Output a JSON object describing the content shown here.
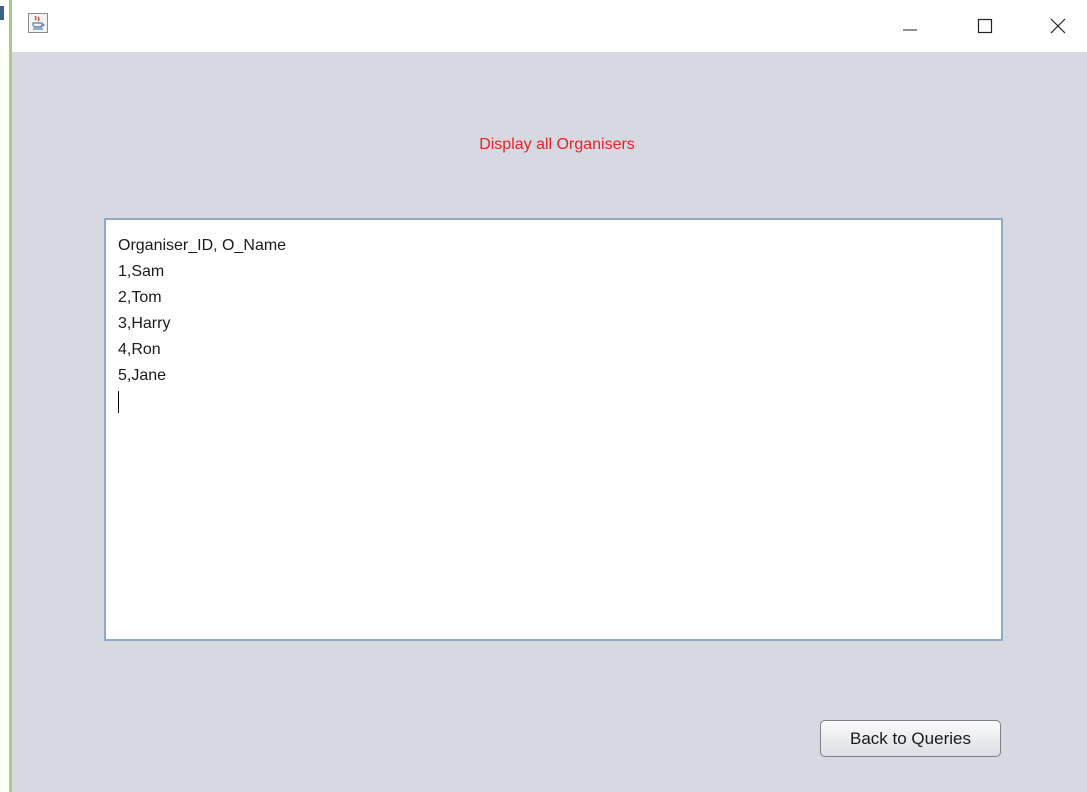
{
  "window": {
    "title": "",
    "controls": {
      "minimize_icon": "minimize-icon",
      "maximize_icon": "maximize-icon",
      "close_icon": "close-icon"
    }
  },
  "content": {
    "title": "Display all Organisers",
    "title_color": "#e8212a",
    "output_lines": [
      "Organiser_ID, O_Name",
      "1,Sam",
      "2,Tom",
      "3,Harry",
      "4,Ron",
      "5,Jane"
    ]
  },
  "buttons": {
    "back_label": "Back to Queries"
  },
  "colors": {
    "window_bg": "#d6d9e0",
    "textarea_border": "#8fa9c9"
  }
}
